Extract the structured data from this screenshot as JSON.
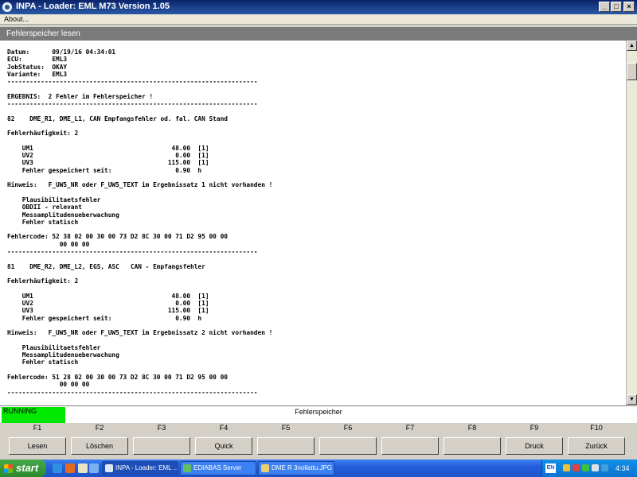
{
  "window": {
    "title": "INPA - Loader:  EML M73 Version 1.05",
    "buttons": {
      "minimize": "_",
      "maximize": "□",
      "close": "×"
    }
  },
  "menu": {
    "about": "About..."
  },
  "panel": {
    "title": "Fehlerspeicher lesen"
  },
  "report": {
    "text": "Datum:      09/19/16 04:34:01\nECU:        EML3\nJobStatus:  OKAY\nVariante:   EML3\n-------------------------------------------------------------------\n\nERGEBNIS:  2 Fehler im Fehlerspeicher !\n-------------------------------------------------------------------\n\n82    DME_R1, DME_L1, CAN Empfangsfehler od. fal. CAN Stand\n\nFehlerhäufigkeit: 2\n\n    UM1                                     48.00  [1]\n    UV2                                      0.00  [1]\n    UV3                                    115.00  [1]\n    Fehler gespeichert seit:                 0.90  h\n\nHinweis:   F_UW5_NR oder F_UW5_TEXT im Ergebnissatz 1 nicht vorhanden !\n\n    Plausibilitaetsfehler\n    OBDII - relevant\n    Messamplitudenueberwachung\n    Fehler statisch\n\nFehlercode: 52 38 02 00 30 00 73 D2 8C 30 00 71 D2 95 00 00\n              00 00 00\n-------------------------------------------------------------------\n\n81    DME_R2, DME_L2, EGS, ASC   CAN - Empfangsfehler\n\nFehlerhäufigkeit: 2\n\n    UM1                                     48.00  [1]\n    UV2                                      0.00  [1]\n    UV3                                    115.00  [1]\n    Fehler gespeichert seit:                 0.90  h\n\nHinweis:   F_UW5_NR oder F_UW5_TEXT im Ergebnissatz 2 nicht vorhanden !\n\n    Plausibilitaetsfehler\n    Messamplitudenueberwachung\n    Fehler statisch\n\nFehlercode: 51 28 02 00 30 00 73 D2 8C 30 00 71 D2 95 00 00\n              00 00 00\n-------------------------------------------------------------------"
  },
  "scrollbar": {
    "up": "▲",
    "down": "▼"
  },
  "status": {
    "running": "RUNNING",
    "title": "Fehlerspeicher"
  },
  "fkeys": [
    {
      "key": "F1",
      "label": "Lesen"
    },
    {
      "key": "F2",
      "label": "Löschen"
    },
    {
      "key": "F3",
      "label": ""
    },
    {
      "key": "F4",
      "label": "Quick"
    },
    {
      "key": "F5",
      "label": ""
    },
    {
      "key": "F6",
      "label": ""
    },
    {
      "key": "F7",
      "label": ""
    },
    {
      "key": "F8",
      "label": ""
    },
    {
      "key": "F9",
      "label": "Druck"
    },
    {
      "key": "F10",
      "label": "Zurück"
    }
  ],
  "taskbar": {
    "start": "start",
    "tasks": [
      {
        "label": "INPA - Loader:  EML ..."
      },
      {
        "label": "EDIABAS Server"
      },
      {
        "label": "DME R 3nollattu.JPG ..."
      }
    ],
    "tray": {
      "lang": "EN",
      "clock": "4:34"
    }
  },
  "colors": {
    "running": "#00e800",
    "taskbar": "#245edc",
    "titlebar": "#0a246a"
  }
}
